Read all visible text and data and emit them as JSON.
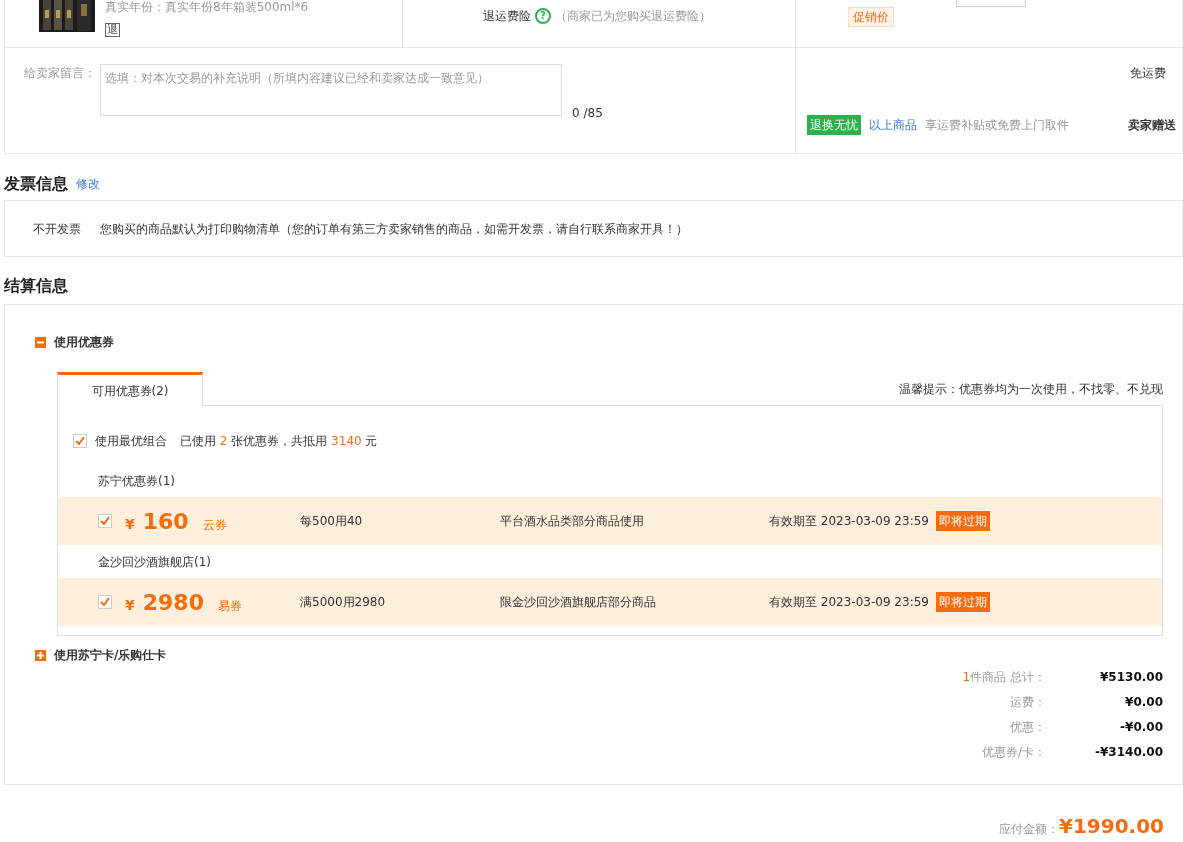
{
  "product": {
    "spec": "真实年份：真实年份8年箱装500ml*6",
    "return_badge": "退",
    "insurance_label": "退运费险",
    "insurance_help": "?",
    "insurance_note": "（商家已为您购买退运费险）",
    "promo_tag": "促销价"
  },
  "message": {
    "label": "给卖家留言：",
    "placeholder": "选填：对本次交易的补充说明（所填内容建议已经和卖家达成一致意见）",
    "counter": "0 /85"
  },
  "shipping": {
    "fee": "免运费",
    "badge": "退换无忧",
    "link": "以上商品",
    "note": "享运费补贴或免费上门取件",
    "gift": "卖家赠送"
  },
  "invoice": {
    "title": "发票信息",
    "edit": "修改",
    "type": "不开发票",
    "note": "您购买的商品默认为打印购物清单（您的订单有第三方卖家销售的商品，如需开发票，请自行联系商家开具！）"
  },
  "settlement": {
    "title": "结算信息",
    "coupon_section": {
      "label": "使用优惠券",
      "expanded": true,
      "tabs": [
        {
          "label": "可用优惠券(2)",
          "selected": true
        }
      ],
      "tip": "温馨提示：优惠券均为一次使用，不找零、不兑现",
      "best_combo": {
        "checked": true,
        "label": "使用最优组合",
        "prefix": "已使用",
        "count": "2",
        "middle": "张优惠券，共抵用",
        "total": "3140",
        "suffix": "元"
      },
      "groups": [
        {
          "name": "苏宁优惠券(1)",
          "coupons": [
            {
              "checked": true,
              "currency": "¥",
              "amount": "160",
              "type": "云券",
              "rule": "每500用40",
              "scope": "平台酒水品类部分商品使用",
              "validity": "有效期至 2023-03-09 23:59",
              "tag": "即将过期"
            }
          ]
        },
        {
          "name": "金沙回沙酒旗舰店(1)",
          "coupons": [
            {
              "checked": true,
              "currency": "¥",
              "amount": "2980",
              "type": "易券",
              "rule": "满5000用2980",
              "scope": "限金沙回沙酒旗舰店部分商品",
              "validity": "有效期至 2023-03-09 23:59",
              "tag": "即将过期"
            }
          ]
        }
      ]
    },
    "card_section": {
      "label": "使用苏宁卡/乐购仕卡",
      "expanded": false
    },
    "summary": [
      {
        "count": "1",
        "label": "件商品 总计：",
        "value": "¥5130.00"
      },
      {
        "label": "运费：",
        "value": "¥0.00"
      },
      {
        "label": "优惠：",
        "value": "-¥0.00"
      },
      {
        "label": "优惠券/卡：",
        "value": "-¥3140.00"
      }
    ]
  },
  "payable": {
    "label": "应付金额：",
    "value": "¥1990.00"
  }
}
